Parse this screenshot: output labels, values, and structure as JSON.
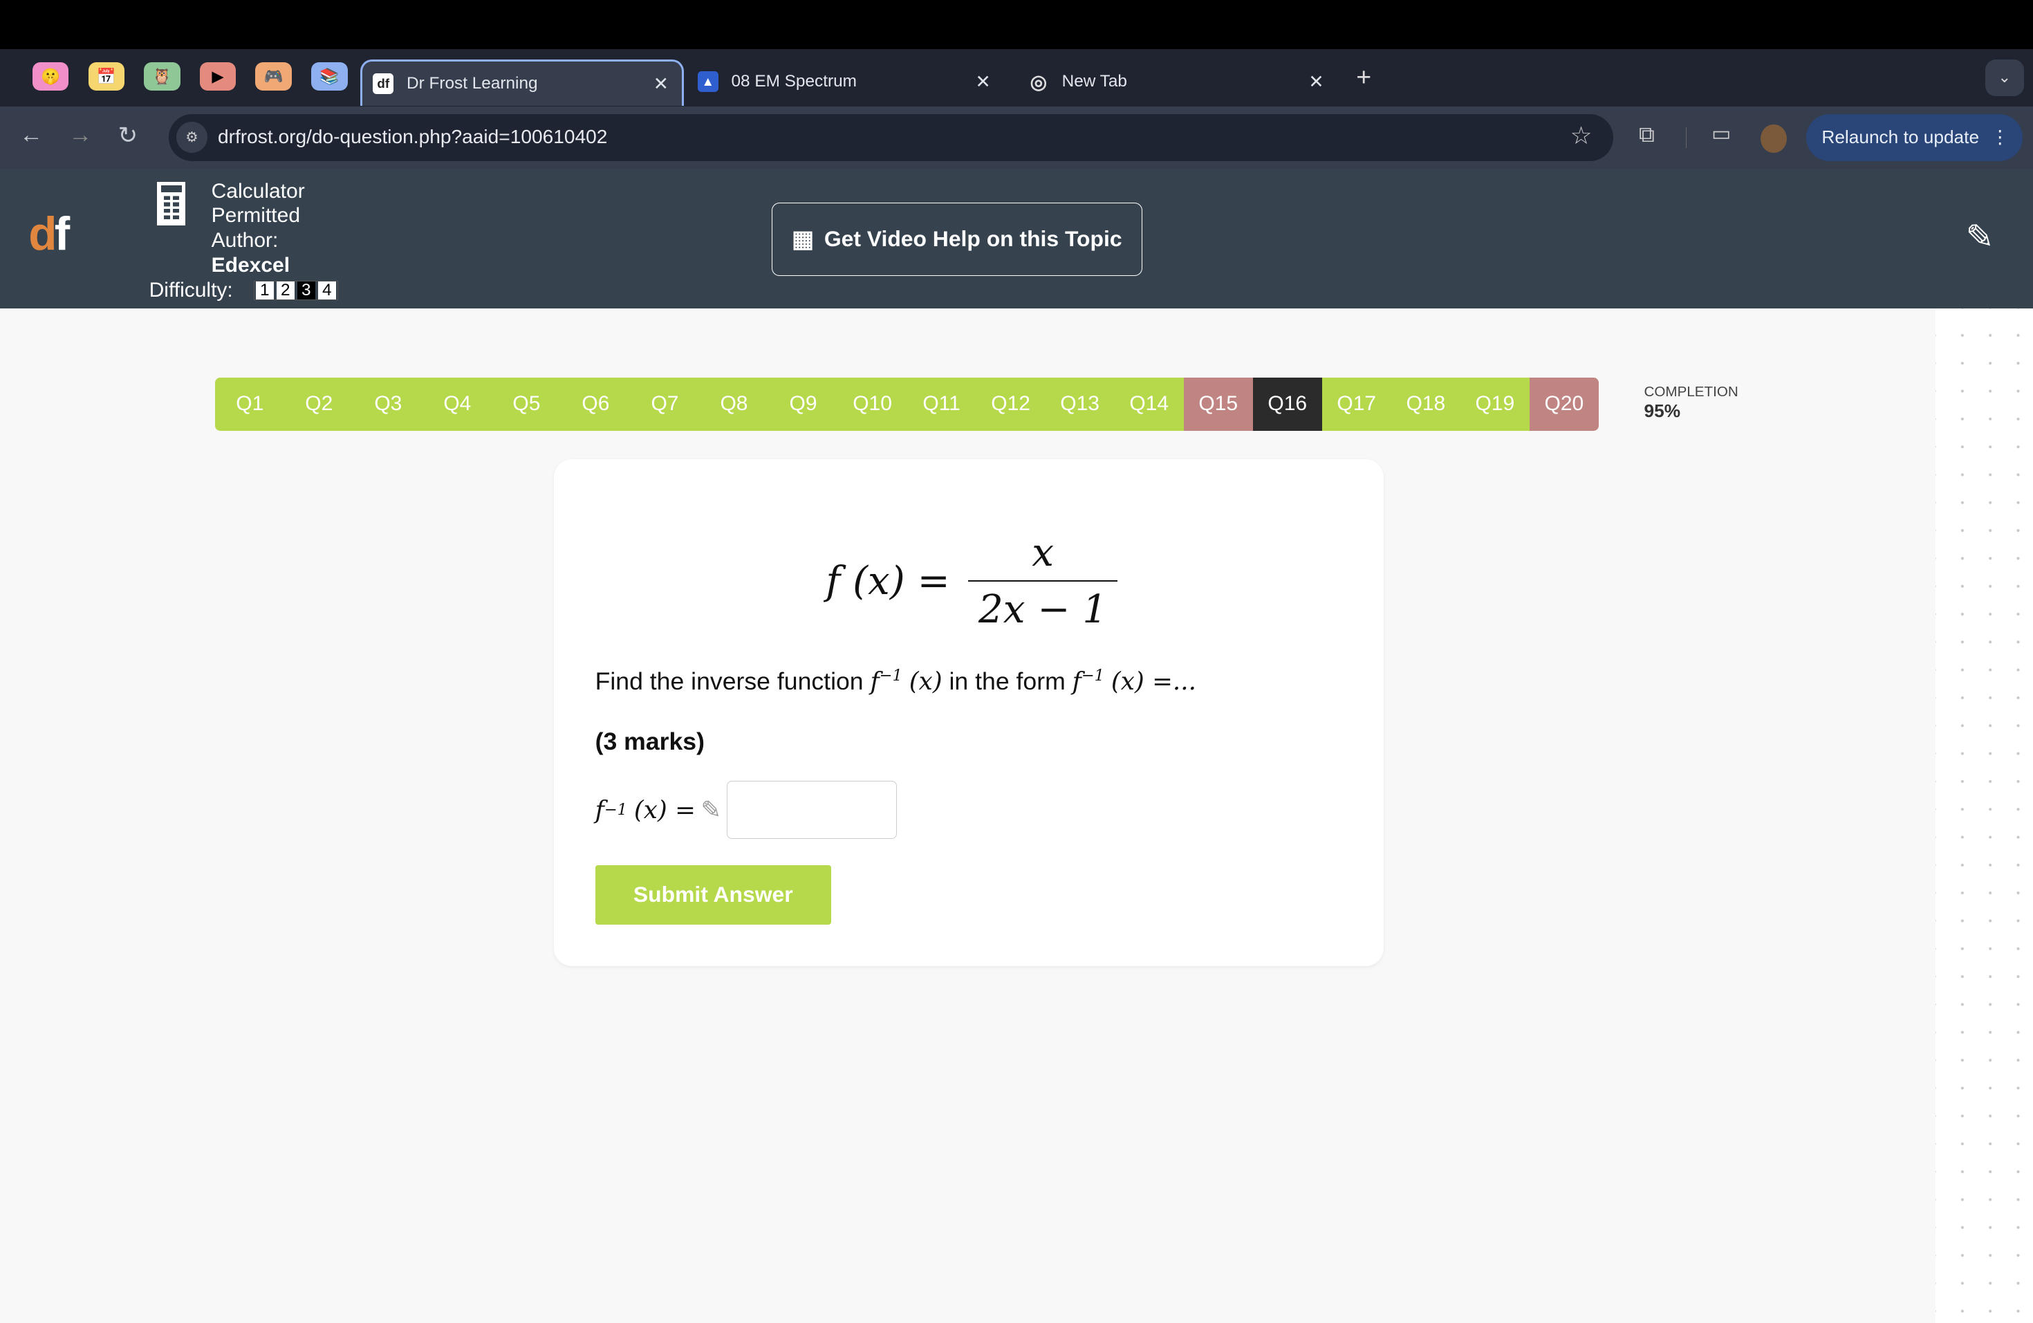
{
  "browser": {
    "pinned_tabs": [
      {
        "icon": "shush-emoji-icon",
        "color": "#f08fc8",
        "glyph": "🤫"
      },
      {
        "icon": "calendar-icon",
        "color": "#f6d66f",
        "glyph": "📅"
      },
      {
        "icon": "owl-icon",
        "color": "#8fc796",
        "glyph": "🦉"
      },
      {
        "icon": "play-icon",
        "color": "#e58a7e",
        "glyph": "▶"
      },
      {
        "icon": "gamepad-icon",
        "color": "#f0a874",
        "glyph": "🎮"
      },
      {
        "icon": "books-icon",
        "color": "#8fb0f0",
        "glyph": "📚"
      }
    ],
    "tabs": [
      {
        "title": "Dr Frost Learning",
        "favicon": "df",
        "active": true
      },
      {
        "title": "08 EM Spectrum",
        "favicon": "classroom-icon",
        "active": false
      },
      {
        "title": "New Tab",
        "favicon": "chrome-icon",
        "active": false
      }
    ],
    "url": "drfrost.org/do-question.php?aaid=100610402",
    "relaunch_label": "Relaunch to update"
  },
  "header": {
    "calculator_line1": "Calculator",
    "calculator_line2": "Permitted",
    "author_label": "Author:",
    "author": "Edexcel",
    "difficulty_label": "Difficulty:",
    "difficulty_levels": [
      "1",
      "2",
      "3",
      "4"
    ],
    "difficulty_selected": 3,
    "video_help_label": "Get Video Help on this Topic"
  },
  "questions": [
    {
      "label": "Q1",
      "status": "correct"
    },
    {
      "label": "Q2",
      "status": "correct"
    },
    {
      "label": "Q3",
      "status": "correct"
    },
    {
      "label": "Q4",
      "status": "correct"
    },
    {
      "label": "Q5",
      "status": "correct"
    },
    {
      "label": "Q6",
      "status": "correct"
    },
    {
      "label": "Q7",
      "status": "correct"
    },
    {
      "label": "Q8",
      "status": "correct"
    },
    {
      "label": "Q9",
      "status": "correct"
    },
    {
      "label": "Q10",
      "status": "correct"
    },
    {
      "label": "Q11",
      "status": "correct"
    },
    {
      "label": "Q12",
      "status": "correct"
    },
    {
      "label": "Q13",
      "status": "correct"
    },
    {
      "label": "Q14",
      "status": "correct"
    },
    {
      "label": "Q15",
      "status": "wrong"
    },
    {
      "label": "Q16",
      "status": "current"
    },
    {
      "label": "Q17",
      "status": "correct"
    },
    {
      "label": "Q18",
      "status": "correct"
    },
    {
      "label": "Q19",
      "status": "correct"
    },
    {
      "label": "Q20",
      "status": "wrong"
    }
  ],
  "completion": {
    "label": "COMPLETION",
    "value": "95%"
  },
  "question": {
    "lhs": "f (x) =",
    "numerator": "x",
    "denominator": "2x − 1",
    "text_before": "Find the inverse function ",
    "inv": "f",
    "inv_sup": "−1",
    "inv_arg": "(x)",
    "text_mid": " in the form ",
    "text_end": " =...",
    "marks": "(3 marks)",
    "answer_lhs": "(x) =",
    "answer_value": "",
    "submit_label": "Submit Answer"
  },
  "colors": {
    "correct": "#b5d94a",
    "wrong": "#c08582",
    "current": "#2b2b2b",
    "header": "#36434f"
  }
}
